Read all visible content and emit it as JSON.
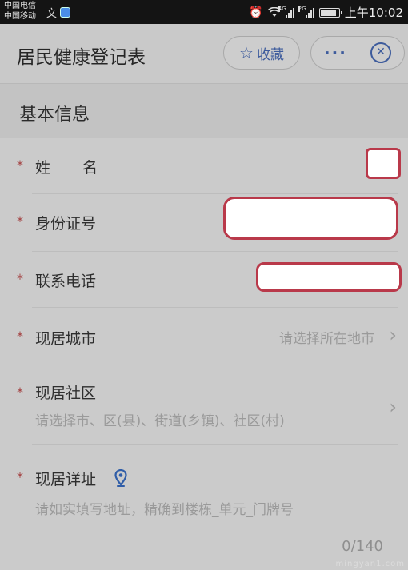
{
  "status_bar": {
    "carrier_1": "中国电信",
    "carrier_2": "中国移动",
    "signal_1_tag": "4G",
    "signal_2_tag": "2G",
    "time": "上午10:02"
  },
  "header": {
    "title": "居民健康登记表",
    "favorite_label": "收藏",
    "more_icon": "···"
  },
  "section": {
    "title": "基本信息"
  },
  "form": {
    "required_mark": "*",
    "name": {
      "label": "姓名"
    },
    "id_number": {
      "label": "身份证号"
    },
    "phone": {
      "label": "联系电话"
    },
    "city": {
      "label": "现居城市",
      "placeholder": "请选择所在地市"
    },
    "community": {
      "label": "现居社区",
      "placeholder": "请选择市、区(县)、街道(乡镇)、社区(村)"
    },
    "address": {
      "label": "现居详址",
      "placeholder": "请如实填写地址，精确到楼栋_单元_门牌号",
      "counter": "0/140"
    }
  },
  "watermark": "mingyan1.com",
  "colors": {
    "accent": "#3d5b9c",
    "required": "#a34040",
    "redaction_border": "#b9394a"
  },
  "icons": [
    "alarm-icon",
    "wifi-icon",
    "battery-icon",
    "star-icon",
    "more-icon",
    "close-icon",
    "chevron-right-icon",
    "location-pin-icon"
  ]
}
